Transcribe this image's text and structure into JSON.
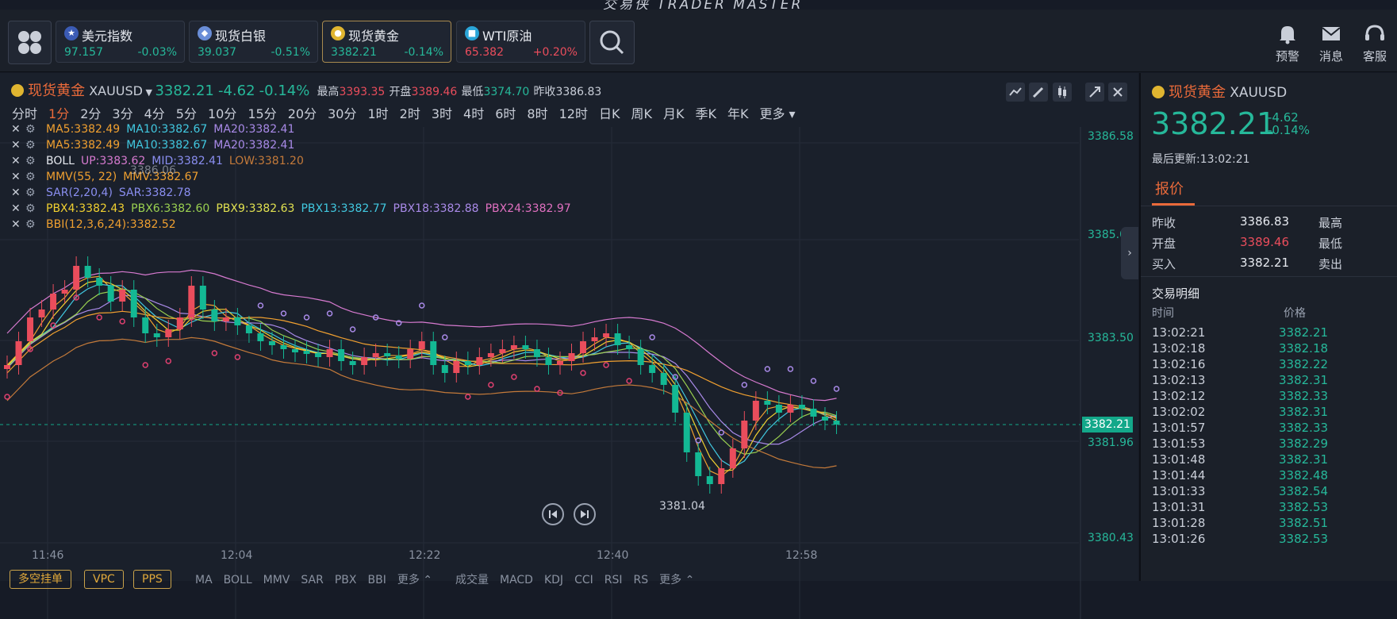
{
  "app": {
    "title": "交易侠 TRADER MASTER"
  },
  "tickers": [
    {
      "name": "美元指数",
      "price": "97.157",
      "change": "-0.03%",
      "color": "#26b89a"
    },
    {
      "name": "现货白银",
      "price": "39.037",
      "change": "-0.51%",
      "color": "#26b89a"
    },
    {
      "name": "现货黄金",
      "price": "3382.21",
      "change": "-0.14%",
      "color": "#26b89a",
      "selected": true
    },
    {
      "name": "WTI原油",
      "price": "65.382",
      "change": "+0.20%",
      "color": "#ea4d5c"
    }
  ],
  "top_right": {
    "alert": "预警",
    "message": "消息",
    "service": "客服"
  },
  "chart_header": {
    "name": "现货黄金",
    "symbol": "XAUUSD",
    "price": "3382.21",
    "change": "-4.62",
    "change_pct": "-0.14%",
    "high_label": "最高",
    "high": "3393.35",
    "open_label": "开盘",
    "open": "3389.46",
    "low_label": "最低",
    "low": "3374.70",
    "prev_label": "昨收",
    "prev": "3386.83"
  },
  "timeframes": [
    "分时",
    "1分",
    "2分",
    "3分",
    "4分",
    "5分",
    "10分",
    "15分",
    "20分",
    "30分",
    "1时",
    "2时",
    "3时",
    "4时",
    "6时",
    "8时",
    "12时",
    "日K",
    "周K",
    "月K",
    "季K",
    "年K",
    "更多"
  ],
  "active_timeframe": "1分",
  "indicators": [
    [
      {
        "t": "MA5:3382.49",
        "c": "#f0a030"
      },
      {
        "t": "MA10:3382.67",
        "c": "#41c8e0"
      },
      {
        "t": "MA20:3382.41",
        "c": "#a98ae8"
      }
    ],
    [
      {
        "t": "MA5:3382.49",
        "c": "#f0a030"
      },
      {
        "t": "MA10:3382.67",
        "c": "#41c8e0"
      },
      {
        "t": "MA20:3382.41",
        "c": "#a98ae8"
      }
    ],
    [
      {
        "t": "BOLL",
        "c": "#e6e9ef"
      },
      {
        "t": "UP:3383.62",
        "c": "#d77ad0"
      },
      {
        "t": "MID:3382.41",
        "c": "#8a8ef0"
      },
      {
        "t": "LOW:3381.20",
        "c": "#c47a3a"
      }
    ],
    [
      {
        "t": "MMV(55, 22)",
        "c": "#f0a030"
      },
      {
        "t": "MMV:3382.67",
        "c": "#f0a030"
      }
    ],
    [
      {
        "t": "SAR(2,20,4)",
        "c": "#8a8ef0"
      },
      {
        "t": "SAR:3382.78",
        "c": "#8a8ef0"
      }
    ],
    [
      {
        "t": "PBX4:3382.43",
        "c": "#f0d030"
      },
      {
        "t": "PBX6:3382.60",
        "c": "#9ad050"
      },
      {
        "t": "PBX9:3382.63",
        "c": "#e0e050"
      },
      {
        "t": "PBX13:3382.77",
        "c": "#41c8e0"
      },
      {
        "t": "PBX18:3382.88",
        "c": "#a98ae8"
      },
      {
        "t": "PBX24:3382.97",
        "c": "#e070c0"
      }
    ],
    [
      {
        "t": "BBI(12,3,6,24):3382.52",
        "c": "#f0a030"
      }
    ]
  ],
  "y_axis": [
    "3386.58",
    "3385.04",
    "3383.50",
    "3381.96",
    "3380.43"
  ],
  "current_price_tag": "3382.21",
  "x_axis": [
    "11:46",
    "12:04",
    "12:22",
    "12:40",
    "12:58"
  ],
  "annotations": {
    "low_marker": "3381.04",
    "high_marker": "3386.06"
  },
  "bottom_buttons": [
    "多空挂单",
    "VPC",
    "PPS"
  ],
  "bottom_tabs_main": [
    "MA",
    "BOLL",
    "MMV",
    "SAR",
    "PBX",
    "BBI",
    "更多"
  ],
  "bottom_tabs_sub": [
    "成交量",
    "MACD",
    "KDJ",
    "CCI",
    "RSI",
    "RS",
    "更多"
  ],
  "right": {
    "name": "现货黄金",
    "symbol": "XAUUSD",
    "price": "3382.21",
    "change": "-4.62",
    "change_pct": "-0.14%",
    "updated": "最后更新:13:02:21",
    "tab": "报价",
    "quotes": [
      {
        "label": "昨收",
        "value": "3386.83",
        "label2": "最高"
      },
      {
        "label": "开盘",
        "value": "3389.46",
        "label2": "最低"
      },
      {
        "label": "买入",
        "value": "3382.21",
        "label2": "卖出"
      }
    ],
    "trades_title": "交易明细",
    "col_time": "时间",
    "col_price": "价格",
    "trades": [
      {
        "time": "13:02:21",
        "price": "3382.21"
      },
      {
        "time": "13:02:18",
        "price": "3382.18"
      },
      {
        "time": "13:02:16",
        "price": "3382.22"
      },
      {
        "time": "13:02:13",
        "price": "3382.31"
      },
      {
        "time": "13:02:12",
        "price": "3382.33"
      },
      {
        "time": "13:02:02",
        "price": "3382.31"
      },
      {
        "time": "13:01:57",
        "price": "3382.33"
      },
      {
        "time": "13:01:53",
        "price": "3382.29"
      },
      {
        "time": "13:01:48",
        "price": "3382.31"
      },
      {
        "time": "13:01:44",
        "price": "3382.48"
      },
      {
        "time": "13:01:33",
        "price": "3382.54"
      },
      {
        "time": "13:01:31",
        "price": "3382.53"
      },
      {
        "time": "13:01:28",
        "price": "3382.51"
      },
      {
        "time": "13:01:26",
        "price": "3382.53"
      }
    ]
  }
}
